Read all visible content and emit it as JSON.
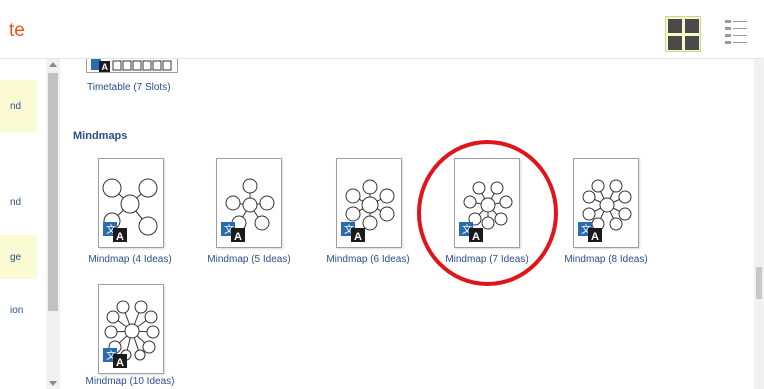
{
  "header": {
    "brand_fragment": "te",
    "grid_view_label": "grid-view",
    "list_view_label": "list-view"
  },
  "sidebar": {
    "items": [
      {
        "label": "nd",
        "highlighted": true
      },
      {
        "label": "nd",
        "highlighted": false
      },
      {
        "label": "ge",
        "highlighted": true
      },
      {
        "label": "ion",
        "highlighted": false
      }
    ]
  },
  "timetable": {
    "label": "Timetable (7 Slots)"
  },
  "mindmaps": {
    "section_title": "Mindmaps",
    "items": [
      {
        "label": "Mindmap (4 Ideas)",
        "ideas": 4
      },
      {
        "label": "Mindmap (5 Ideas)",
        "ideas": 5
      },
      {
        "label": "Mindmap (6 Ideas)",
        "ideas": 6
      },
      {
        "label": "Mindmap (7 Ideas)",
        "ideas": 7,
        "circled": true
      },
      {
        "label": "Mindmap (8 Ideas)",
        "ideas": 8
      },
      {
        "label": "Mindmap (10 Ideas)",
        "ideas": 10
      }
    ]
  },
  "colors": {
    "accent_text": "#2a4f8f",
    "brand": "#e2561b",
    "highlight_ring": "#e0141b",
    "selected_view_bg": "#f7f7c9"
  }
}
